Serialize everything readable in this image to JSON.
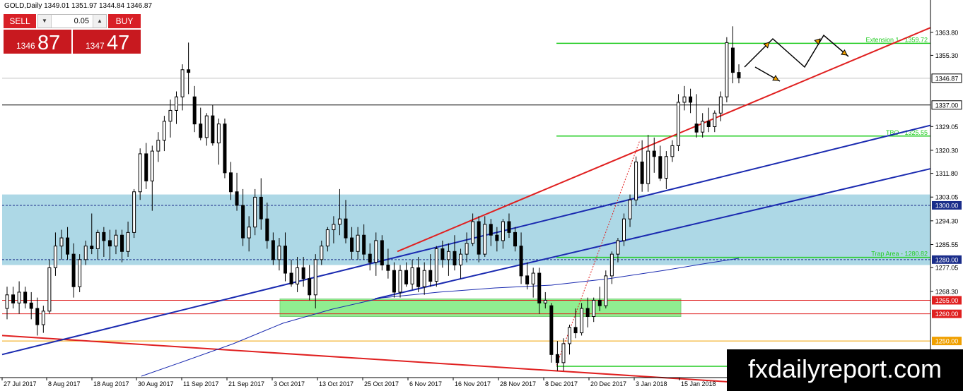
{
  "header": {
    "title": "GOLD,Daily  1349.01 1351.97 1344.84 1346.87"
  },
  "trade_panel": {
    "sell_label": "SELL",
    "buy_label": "BUY",
    "lot_value": "0.05",
    "sell_small": "1346",
    "sell_big": "87",
    "buy_small": "1347",
    "buy_big": "47"
  },
  "watermark": "fxdailyreport.com",
  "chart_data": {
    "type": "candlestick",
    "symbol": "GOLD",
    "timeframe": "Daily",
    "ohlc_last": {
      "open": 1349.01,
      "high": 1351.97,
      "low": 1344.84,
      "close": 1346.87
    },
    "ylim": [
      1236.5,
      1370.5
    ],
    "y_ticks": [
      "1363.80",
      "1355.30",
      "1346.87",
      "1337.00",
      "1329.05",
      "1320.30",
      "1311.80",
      "1303.05",
      "1300.00",
      "1294.30",
      "1285.55",
      "1280.00",
      "1277.05",
      "1268.30",
      "1265.00",
      "1260.00",
      "1250.00"
    ],
    "x_ticks": [
      "27 Jul 2017",
      "8 Aug 2017",
      "18 Aug 2017",
      "30 Aug 2017",
      "11 Sep 2017",
      "21 Sep 2017",
      "3 Oct 2017",
      "13 Oct 2017",
      "25 Oct 2017",
      "6 Nov 2017",
      "16 Nov 2017",
      "28 Nov 2017",
      "8 Dec 2017",
      "20 Dec 2017",
      "3 Jan 2018",
      "15 Jan 2018"
    ],
    "levels": [
      {
        "value": 1359.72,
        "label": "Extension 1 - 1359.72",
        "color": "#22cc22"
      },
      {
        "value": 1325.55,
        "label": "TBO - 1325.55",
        "color": "#22cc22"
      },
      {
        "value": 1280.82,
        "label": "Trap Area - 1280.82",
        "color": "#22cc22"
      },
      {
        "value": 1337.0,
        "color": "#000000"
      },
      {
        "value": 1300.0,
        "color": "#1a2d8a",
        "style": "dashed"
      },
      {
        "value": 1280.0,
        "color": "#1a2d8a",
        "style": "dashed"
      },
      {
        "value": 1265.0,
        "color": "#e02020"
      },
      {
        "value": 1260.0,
        "color": "#e02020"
      },
      {
        "value": 1250.0,
        "color": "#f0a000"
      }
    ],
    "zones": [
      {
        "from": 1278.0,
        "to": 1304.0,
        "color": "#add8e6"
      },
      {
        "from": 1259.0,
        "to": 1265.5,
        "color": "#90ee90"
      }
    ],
    "candles": [
      [
        1262,
        1270,
        1258,
        1267
      ],
      [
        1267,
        1270,
        1262,
        1264
      ],
      [
        1264,
        1272,
        1260,
        1268
      ],
      [
        1268,
        1270,
        1262,
        1264
      ],
      [
        1264,
        1268,
        1258,
        1262
      ],
      [
        1262,
        1266,
        1252,
        1256
      ],
      [
        1256,
        1263,
        1253,
        1261
      ],
      [
        1261,
        1280,
        1260,
        1277
      ],
      [
        1277,
        1290,
        1274,
        1285
      ],
      [
        1285,
        1291,
        1280,
        1288
      ],
      [
        1288,
        1292,
        1280,
        1282
      ],
      [
        1282,
        1286,
        1266,
        1270
      ],
      [
        1270,
        1282,
        1268,
        1280
      ],
      [
        1280,
        1287,
        1278,
        1285
      ],
      [
        1285,
        1297,
        1282,
        1284
      ],
      [
        1284,
        1291,
        1280,
        1290
      ],
      [
        1290,
        1292,
        1281,
        1287
      ],
      [
        1287,
        1291,
        1280,
        1285
      ],
      [
        1285,
        1291,
        1282,
        1289
      ],
      [
        1289,
        1291,
        1279,
        1283
      ],
      [
        1283,
        1294,
        1281,
        1290
      ],
      [
        1290,
        1306,
        1288,
        1305
      ],
      [
        1305,
        1321,
        1302,
        1319
      ],
      [
        1319,
        1323,
        1306,
        1309
      ],
      [
        1309,
        1322,
        1298,
        1320
      ],
      [
        1320,
        1327,
        1316,
        1324
      ],
      [
        1324,
        1333,
        1320,
        1331
      ],
      [
        1331,
        1339,
        1325,
        1335
      ],
      [
        1335,
        1342,
        1330,
        1340
      ],
      [
        1340,
        1352,
        1335,
        1350
      ],
      [
        1350,
        1360,
        1341,
        1349
      ],
      [
        1340,
        1344,
        1327,
        1330
      ],
      [
        1330,
        1336,
        1324,
        1325
      ],
      [
        1325,
        1334,
        1322,
        1333
      ],
      [
        1333,
        1337,
        1322,
        1323
      ],
      [
        1323,
        1332,
        1315,
        1330
      ],
      [
        1330,
        1332,
        1310,
        1312
      ],
      [
        1312,
        1316,
        1302,
        1305
      ],
      [
        1305,
        1312,
        1298,
        1300
      ],
      [
        1300,
        1306,
        1285,
        1288
      ],
      [
        1288,
        1296,
        1283,
        1292
      ],
      [
        1292,
        1306,
        1289,
        1303
      ],
      [
        1303,
        1310,
        1291,
        1295
      ],
      [
        1295,
        1301,
        1284,
        1287
      ],
      [
        1287,
        1290,
        1278,
        1280
      ],
      [
        1280,
        1288,
        1276,
        1285
      ],
      [
        1285,
        1290,
        1272,
        1275
      ],
      [
        1275,
        1280,
        1270,
        1271
      ],
      [
        1271,
        1281,
        1268,
        1277
      ],
      [
        1277,
        1281,
        1270,
        1273
      ],
      [
        1273,
        1278,
        1265,
        1267
      ],
      [
        1267,
        1282,
        1262,
        1280
      ],
      [
        1280,
        1287,
        1278,
        1285
      ],
      [
        1285,
        1292,
        1283,
        1291
      ],
      [
        1291,
        1296,
        1286,
        1293
      ],
      [
        1293,
        1306,
        1289,
        1295
      ],
      [
        1295,
        1302,
        1286,
        1288
      ],
      [
        1288,
        1292,
        1280,
        1283
      ],
      [
        1283,
        1292,
        1280,
        1289
      ],
      [
        1289,
        1293,
        1280,
        1282
      ],
      [
        1282,
        1286,
        1276,
        1279
      ],
      [
        1279,
        1290,
        1274,
        1287
      ],
      [
        1287,
        1289,
        1276,
        1278
      ],
      [
        1278,
        1284,
        1273,
        1276
      ],
      [
        1276,
        1279,
        1266,
        1268
      ],
      [
        1268,
        1278,
        1266,
        1276
      ],
      [
        1276,
        1279,
        1270,
        1271
      ],
      [
        1271,
        1280,
        1269,
        1277
      ],
      [
        1277,
        1281,
        1268,
        1270
      ],
      [
        1270,
        1279,
        1267,
        1276
      ],
      [
        1276,
        1282,
        1270,
        1272
      ],
      [
        1272,
        1285,
        1270,
        1284
      ],
      [
        1284,
        1287,
        1277,
        1280
      ],
      [
        1280,
        1286,
        1274,
        1283
      ],
      [
        1283,
        1289,
        1276,
        1278
      ],
      [
        1278,
        1284,
        1273,
        1282
      ],
      [
        1282,
        1290,
        1279,
        1286
      ],
      [
        1286,
        1297,
        1285,
        1294
      ],
      [
        1294,
        1296,
        1279,
        1282
      ],
      [
        1282,
        1296,
        1281,
        1293
      ],
      [
        1293,
        1295,
        1285,
        1289
      ],
      [
        1289,
        1292,
        1283,
        1287
      ],
      [
        1287,
        1295,
        1284,
        1294
      ],
      [
        1294,
        1297,
        1288,
        1290
      ],
      [
        1290,
        1292,
        1283,
        1285
      ],
      [
        1285,
        1290,
        1271,
        1274
      ],
      [
        1274,
        1279,
        1269,
        1271
      ],
      [
        1271,
        1277,
        1266,
        1275
      ],
      [
        1275,
        1277,
        1260,
        1264
      ],
      [
        1264,
        1268,
        1262,
        1265
      ],
      [
        1263,
        1264,
        1242,
        1245
      ],
      [
        1245,
        1250,
        1239,
        1242
      ],
      [
        1242,
        1251,
        1239,
        1249
      ],
      [
        1249,
        1256,
        1245,
        1255
      ],
      [
        1255,
        1262,
        1251,
        1253
      ],
      [
        1253,
        1264,
        1252,
        1262
      ],
      [
        1262,
        1266,
        1255,
        1259
      ],
      [
        1259,
        1266,
        1257,
        1265
      ],
      [
        1265,
        1270,
        1261,
        1263
      ],
      [
        1263,
        1276,
        1262,
        1274
      ],
      [
        1274,
        1283,
        1271,
        1282
      ],
      [
        1282,
        1288,
        1279,
        1287
      ],
      [
        1287,
        1297,
        1285,
        1295
      ],
      [
        1295,
        1304,
        1292,
        1302
      ],
      [
        1302,
        1318,
        1300,
        1316
      ],
      [
        1316,
        1324,
        1305,
        1308
      ],
      [
        1308,
        1326,
        1305,
        1320
      ],
      [
        1320,
        1325,
        1312,
        1318
      ],
      [
        1318,
        1322,
        1309,
        1310
      ],
      [
        1310,
        1320,
        1306,
        1318
      ],
      [
        1318,
        1324,
        1316,
        1322
      ],
      [
        1322,
        1341,
        1320,
        1338
      ],
      [
        1338,
        1344,
        1335,
        1340
      ],
      [
        1340,
        1343,
        1334,
        1338
      ],
      [
        1330,
        1341,
        1325,
        1327
      ],
      [
        1327,
        1334,
        1325,
        1331
      ],
      [
        1331,
        1336,
        1327,
        1329
      ],
      [
        1329,
        1335,
        1327,
        1334
      ],
      [
        1334,
        1342,
        1331,
        1340
      ],
      [
        1340,
        1362,
        1338,
        1360
      ],
      [
        1358,
        1366,
        1345,
        1349
      ],
      [
        1349,
        1352,
        1345,
        1347
      ]
    ],
    "trend_lines": [
      {
        "name": "red channel",
        "color": "#e02020"
      },
      {
        "name": "blue channel",
        "color": "#1a2ab0"
      },
      {
        "name": "moving average",
        "color": "#1a2ab0"
      }
    ]
  }
}
